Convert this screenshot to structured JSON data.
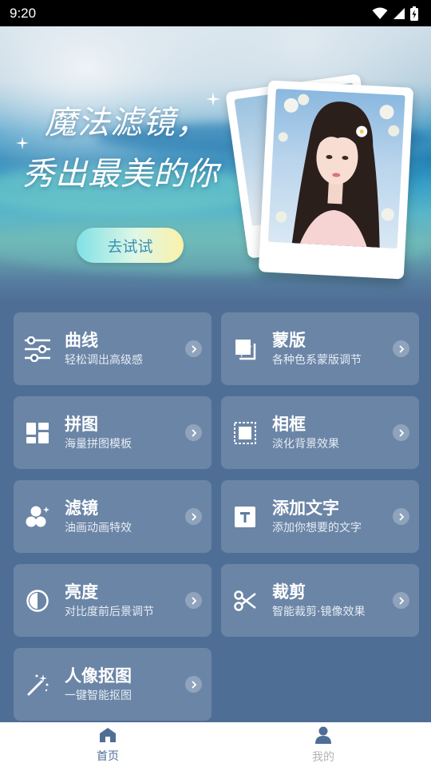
{
  "status_bar": {
    "time": "9:20",
    "icons": [
      "wifi-icon",
      "signal-icon",
      "battery-charging-icon"
    ]
  },
  "banner": {
    "title_line1": "魔法滤镜，",
    "title_line2": "秀出最美的你",
    "button_label": "去试试"
  },
  "features": [
    {
      "title": "曲线",
      "subtitle": "轻松调出高级感",
      "icon": "sliders-icon"
    },
    {
      "title": "蒙版",
      "subtitle": "各种色系蒙版调节",
      "icon": "mask-layers-icon"
    },
    {
      "title": "拼图",
      "subtitle": "海量拼图模板",
      "icon": "collage-layout-icon"
    },
    {
      "title": "相框",
      "subtitle": "淡化背景效果",
      "icon": "frame-icon"
    },
    {
      "title": "滤镜",
      "subtitle": "油画动画特效",
      "icon": "filter-bubbles-icon"
    },
    {
      "title": "添加文字",
      "subtitle": "添加你想要的文字",
      "icon": "text-box-icon"
    },
    {
      "title": "亮度",
      "subtitle": "对比度前后景调节",
      "icon": "contrast-icon"
    },
    {
      "title": "裁剪",
      "subtitle": "智能裁剪·镜像效果",
      "icon": "scissors-icon"
    },
    {
      "title": "人像抠图",
      "subtitle": "一键智能抠图",
      "icon": "magic-wand-icon"
    }
  ],
  "bottom_nav": {
    "items": [
      {
        "label": "首页",
        "icon": "home-icon",
        "active": true
      },
      {
        "label": "我的",
        "icon": "person-icon",
        "active": false
      }
    ]
  },
  "colors": {
    "background": "#4f6e96",
    "card": "rgba(255,255,255,0.16)",
    "nav_active": "#4f6e96",
    "nav_inactive": "#b3b3b3"
  }
}
